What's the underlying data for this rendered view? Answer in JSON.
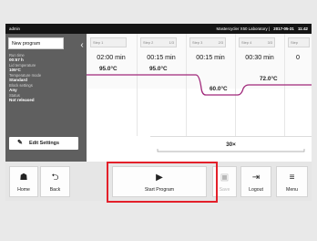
{
  "topbar": {
    "user": "admin",
    "device": "Mastercycler X50 Laboratory",
    "date": "2017-05-31",
    "time": "11:42"
  },
  "sidebar": {
    "program_name": "New program",
    "collapse_icon": "chevron-left-icon",
    "info": [
      {
        "label": "Run time",
        "value": "00:57 h"
      },
      {
        "label": "Lid temperature",
        "value": "105°C"
      },
      {
        "label": "Temperature mode",
        "value": "Standard"
      },
      {
        "label": "Block settings",
        "value": "Any"
      },
      {
        "label": "Status",
        "value": "Not released"
      }
    ],
    "edit_button": {
      "icon": "pencil-icon",
      "label": "Edit Settings"
    }
  },
  "steps": [
    {
      "name": "Step 1",
      "fraction": "",
      "time": "02:00 min",
      "temp": "95.0°C"
    },
    {
      "name": "Step 2",
      "fraction": "1/3",
      "time": "00:15 min",
      "temp": "95.0°C"
    },
    {
      "name": "Step 3",
      "fraction": "2/3",
      "time": "00:15 min",
      "temp": "60.0°C"
    },
    {
      "name": "Step 4",
      "fraction": "3/3",
      "time": "00:30 min",
      "temp": "72.0°C"
    },
    {
      "name": "Step",
      "fraction": "",
      "time": "0"
    }
  ],
  "cycles": "30×",
  "accent_color": "#a0287a",
  "highlight_color": "#e3202a",
  "bottombar": {
    "home": {
      "label": "Home",
      "icon": "home-icon"
    },
    "back": {
      "label": "Back",
      "icon": "back-arrow-icon"
    },
    "start": {
      "label": "Start Program",
      "icon": "play-icon"
    },
    "save": {
      "label": "Save",
      "icon": "save-icon"
    },
    "logout": {
      "label": "Logout",
      "icon": "logout-icon"
    },
    "menu": {
      "label": "Menu",
      "icon": "menu-icon"
    }
  }
}
